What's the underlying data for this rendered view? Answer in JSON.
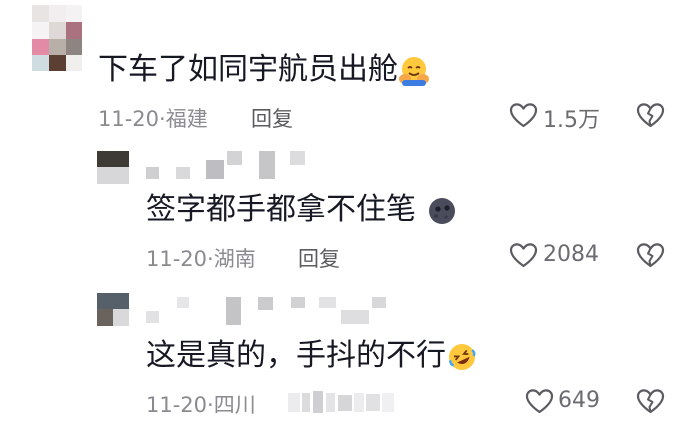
{
  "comments": [
    {
      "text": "下车了如同宇航员出舱",
      "emoji": "hugging-face",
      "date": "11-20",
      "location": "福建",
      "reply_label": "回复",
      "likes": "1.5万"
    },
    {
      "text": "签字都手都拿不住笔",
      "emoji": "new-moon-face",
      "date": "11-20",
      "location": "湖南",
      "reply_label": "回复",
      "likes": "2084"
    },
    {
      "text": "这是真的，手抖的不行",
      "emoji": "rolling-on-floor-laughing",
      "date": "11-20",
      "location": "四川",
      "reply_label": "",
      "likes": "649"
    }
  ],
  "separator": "·",
  "colors": {
    "text": "#161823",
    "meta": "#8a8b91",
    "icon": "#5b5c61"
  }
}
